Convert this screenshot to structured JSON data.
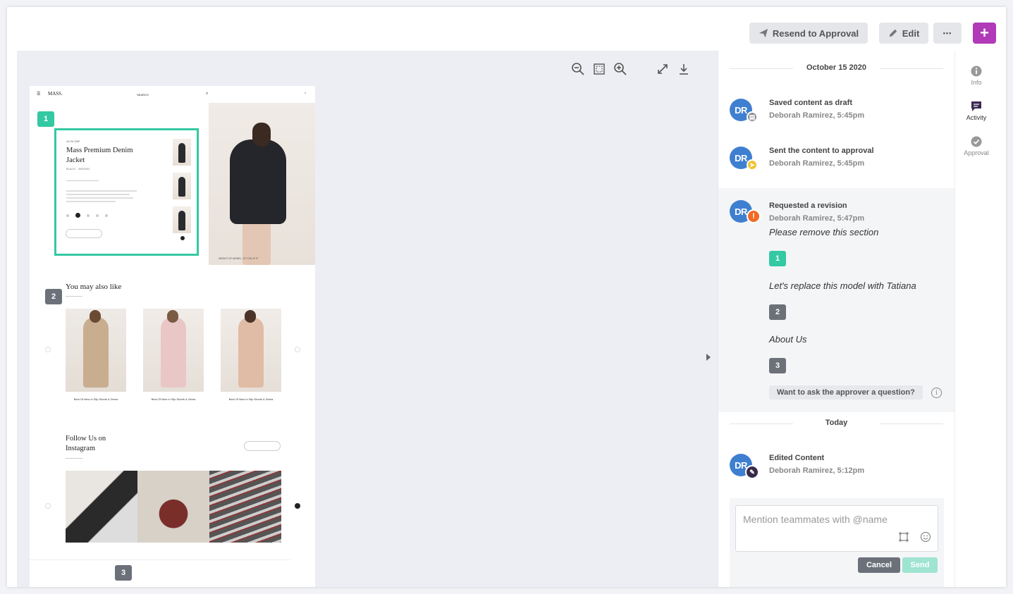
{
  "header": {
    "resend_label": "Resend to Approval",
    "edit_label": "Edit",
    "more_label": "•••",
    "add_label": "+",
    "accent_color": "#b03ab8"
  },
  "preview": {
    "nav_logo": "MASS.",
    "nav_search": "SEARCH",
    "product_price": "49.99 GBP",
    "product_title": "Mass Premium Denim Jacket",
    "product_sub": "BLACK · 3005/202",
    "hero_caption": "HEIGHT OF MODEL: 177 CM / 5' 9\"",
    "section_you_may": "You may also like",
    "products": [
      {
        "caption": "Best Of New In Slip Skorts & Zebra"
      },
      {
        "caption": "Best Of New In Slip Skorts & Zebra"
      },
      {
        "caption": "Best Of New In Slip Skorts & Zebra"
      }
    ],
    "section_follow": "Follow Us on Instagram",
    "markers": [
      "1",
      "2",
      "3"
    ]
  },
  "toolbar": {
    "icons": [
      "zoom-out-icon",
      "fit-screen-icon",
      "zoom-in-icon",
      "expand-icon",
      "download-icon"
    ]
  },
  "activity": {
    "date1": "October 15 2020",
    "date2": "Today",
    "items": [
      {
        "avatar": "DR",
        "title": "Saved content as draft",
        "meta": "Deborah Ramirez, 5:45pm",
        "badge_color": "#8a8d93"
      },
      {
        "avatar": "DR",
        "title": "Sent the content to approval",
        "meta": "Deborah Ramirez, 5:45pm",
        "badge_color": "#f2c230"
      },
      {
        "avatar": "DR",
        "title": "Requested a revision",
        "meta": "Deborah Ramirez, 5:47pm",
        "badge_color": "#f06a25",
        "badge_glyph": "!"
      },
      {
        "avatar": "DR",
        "title": "Edited Content",
        "meta": "Deborah Ramirez, 5:12pm",
        "badge_color": "#3a2a4a"
      }
    ],
    "comments": [
      {
        "text": "Please remove this section",
        "marker": "1"
      },
      {
        "text": "Let's replace this model with Tatiana",
        "marker": "2"
      },
      {
        "text": "About Us",
        "marker": "3"
      }
    ],
    "ask_label": "Want to ask the approver a question?",
    "info_glyph": "i"
  },
  "composer": {
    "placeholder": "Mention teammates with @name",
    "cancel_label": "Cancel",
    "send_label": "Send"
  },
  "rail": {
    "items": [
      {
        "label": "Info",
        "icon": "info-icon"
      },
      {
        "label": "Activity",
        "icon": "chat-icon"
      },
      {
        "label": "Approval",
        "icon": "check-circle-icon"
      }
    ]
  }
}
